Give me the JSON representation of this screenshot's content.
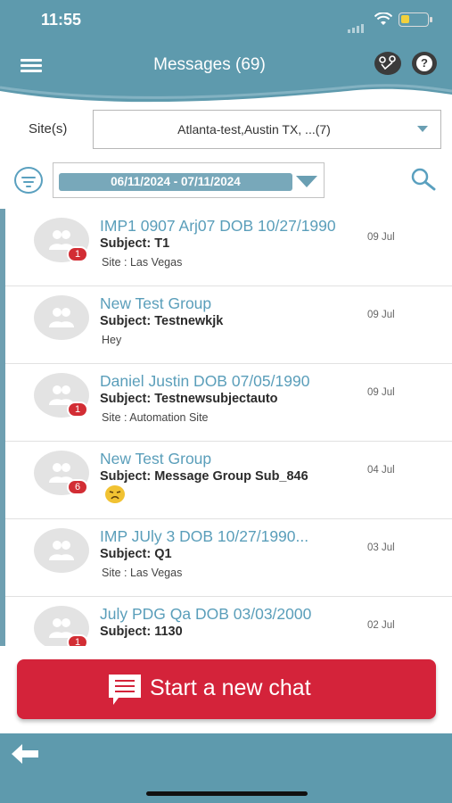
{
  "status_bar": {
    "time": "11:55"
  },
  "header": {
    "title": "Messages (69)"
  },
  "filters": {
    "site_label": "Site(s)",
    "site_value": "Atlanta-test,Austin TX, ...(7)",
    "date_range": "06/11/2024 - 07/11/2024"
  },
  "messages": [
    {
      "title": "IMP1 0907 Arj07 DOB 10/27/1990",
      "subject": "Subject: T1",
      "site": "Site : Las Vegas",
      "date": "09 Jul",
      "badge": "1"
    },
    {
      "title": "New Test Group",
      "subject": "Subject: Testnewkjk",
      "preview": "Hey",
      "date": "09 Jul"
    },
    {
      "title": "Daniel Justin DOB 07/05/1990",
      "subject": "Subject: Testnewsubjectauto",
      "site": "Site : Automation Site",
      "date": "09 Jul",
      "badge": "1"
    },
    {
      "title": "New Test Group",
      "subject": "Subject: Message Group Sub_846",
      "date": "04 Jul",
      "badge": "6",
      "emoji": "disappointed-face"
    },
    {
      "title": "IMP JUly 3 DOB 10/27/1990...",
      "subject": "Subject: Q1",
      "site": "Site : Las Vegas",
      "date": "03 Jul"
    },
    {
      "title": "July PDG Qa DOB 03/03/2000",
      "subject": "Subject: 1130",
      "date": "02 Jul",
      "badge": "1"
    }
  ],
  "actions": {
    "start_chat_label": "Start a new chat"
  },
  "colors": {
    "header": "#5e9aad",
    "accent_text": "#5a9eba",
    "primary_button": "#d4233a",
    "badge": "#d22d34"
  }
}
